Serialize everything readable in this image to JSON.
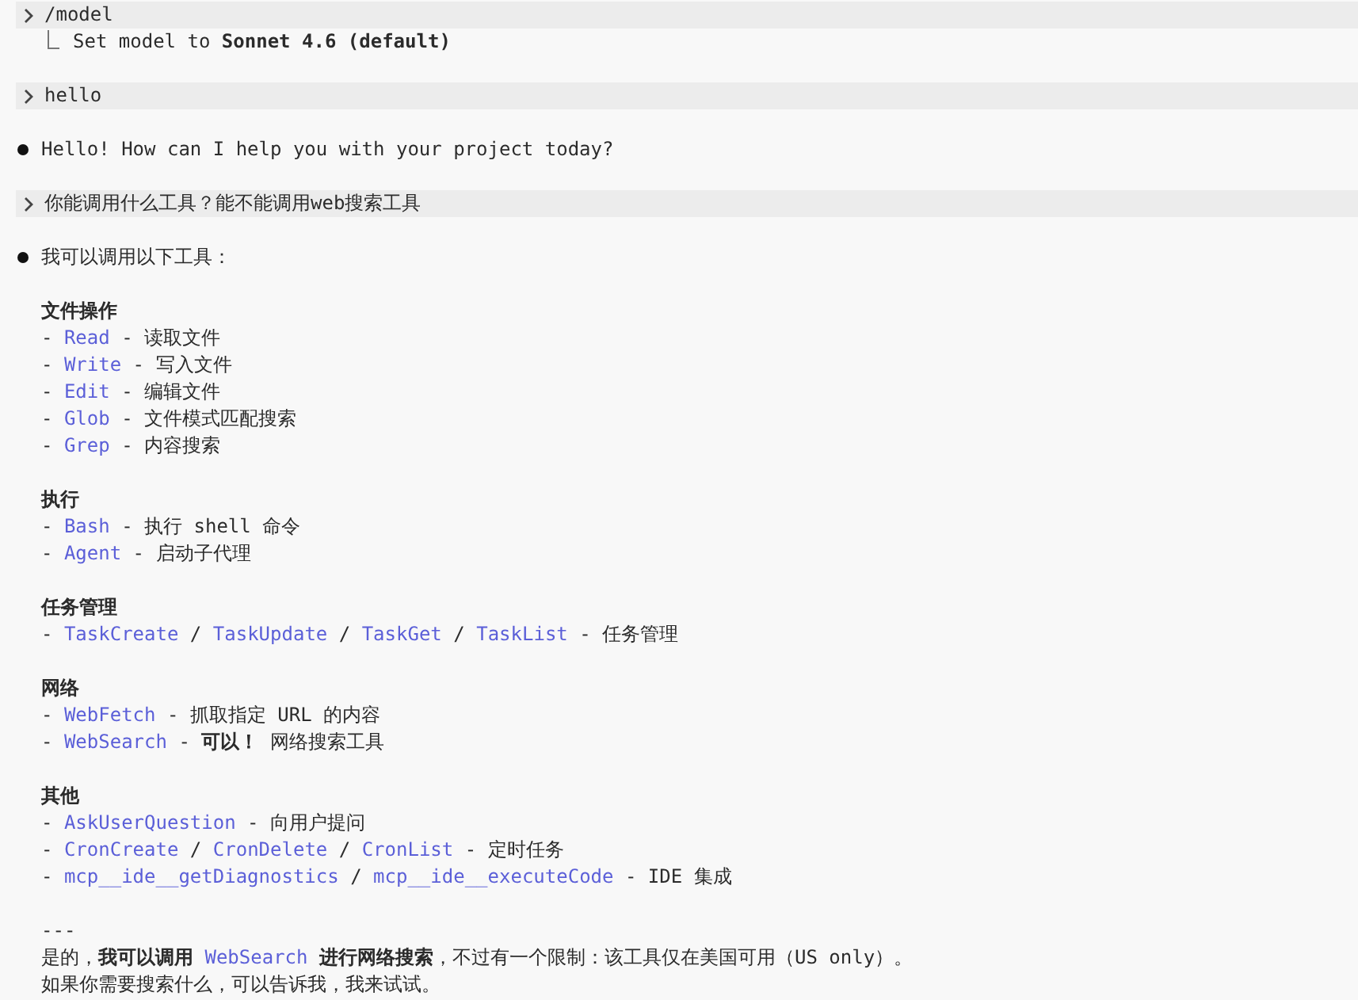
{
  "transcript": [
    {
      "kind": "prompt",
      "text": "/model",
      "result": "Set model to **Sonnet 4.6 (default)**"
    },
    {
      "kind": "prompt",
      "text": "hello"
    },
    {
      "kind": "reply",
      "intro": "Hello! How can I help you with your project today?"
    },
    {
      "kind": "prompt",
      "text": "你能调用什么工具？能不能调用web搜索工具"
    },
    {
      "kind": "reply",
      "intro": "我可以调用以下工具：",
      "sections": [
        {
          "heading": "文件操作",
          "items": [
            [
              {
                "kind": "text",
                "text": "- "
              },
              {
                "kind": "tool",
                "text": "Read"
              },
              {
                "kind": "text",
                "text": " - 读取文件"
              }
            ],
            [
              {
                "kind": "text",
                "text": "- "
              },
              {
                "kind": "tool",
                "text": "Write"
              },
              {
                "kind": "text",
                "text": " - 写入文件"
              }
            ],
            [
              {
                "kind": "text",
                "text": "- "
              },
              {
                "kind": "tool",
                "text": "Edit"
              },
              {
                "kind": "text",
                "text": " - 编辑文件"
              }
            ],
            [
              {
                "kind": "text",
                "text": "- "
              },
              {
                "kind": "tool",
                "text": "Glob"
              },
              {
                "kind": "text",
                "text": " - 文件模式匹配搜索"
              }
            ],
            [
              {
                "kind": "text",
                "text": "- "
              },
              {
                "kind": "tool",
                "text": "Grep"
              },
              {
                "kind": "text",
                "text": " - 内容搜索"
              }
            ]
          ]
        },
        {
          "heading": "执行",
          "items": [
            [
              {
                "kind": "text",
                "text": "- "
              },
              {
                "kind": "tool",
                "text": "Bash"
              },
              {
                "kind": "text",
                "text": " - 执行 shell 命令"
              }
            ],
            [
              {
                "kind": "text",
                "text": "- "
              },
              {
                "kind": "tool",
                "text": "Agent"
              },
              {
                "kind": "text",
                "text": " - 启动子代理"
              }
            ]
          ]
        },
        {
          "heading": "任务管理",
          "items": [
            [
              {
                "kind": "text",
                "text": "- "
              },
              {
                "kind": "tool",
                "text": "TaskCreate"
              },
              {
                "kind": "text",
                "text": " / "
              },
              {
                "kind": "tool",
                "text": "TaskUpdate"
              },
              {
                "kind": "text",
                "text": " / "
              },
              {
                "kind": "tool",
                "text": "TaskGet"
              },
              {
                "kind": "text",
                "text": " / "
              },
              {
                "kind": "tool",
                "text": "TaskList"
              },
              {
                "kind": "text",
                "text": " - 任务管理"
              }
            ]
          ]
        },
        {
          "heading": "网络",
          "items": [
            [
              {
                "kind": "text",
                "text": "- "
              },
              {
                "kind": "tool",
                "text": "WebFetch"
              },
              {
                "kind": "text",
                "text": " - 抓取指定 URL 的内容"
              }
            ],
            [
              {
                "kind": "text",
                "text": "- "
              },
              {
                "kind": "tool",
                "text": "WebSearch"
              },
              {
                "kind": "text",
                "text": " - **可以！** 网络搜索工具"
              }
            ]
          ]
        },
        {
          "heading": "其他",
          "items": [
            [
              {
                "kind": "text",
                "text": "- "
              },
              {
                "kind": "tool",
                "text": "AskUserQuestion"
              },
              {
                "kind": "text",
                "text": " - 向用户提问"
              }
            ],
            [
              {
                "kind": "text",
                "text": "- "
              },
              {
                "kind": "tool",
                "text": "CronCreate"
              },
              {
                "kind": "text",
                "text": " / "
              },
              {
                "kind": "tool",
                "text": "CronDelete"
              },
              {
                "kind": "text",
                "text": " / "
              },
              {
                "kind": "tool",
                "text": "CronList"
              },
              {
                "kind": "text",
                "text": " - 定时任务"
              }
            ],
            [
              {
                "kind": "text",
                "text": "- "
              },
              {
                "kind": "tool",
                "text": "mcp__ide__getDiagnostics"
              },
              {
                "kind": "text",
                "text": " / "
              },
              {
                "kind": "tool",
                "text": "mcp__ide__executeCode"
              },
              {
                "kind": "text",
                "text": " - IDE 集成"
              }
            ]
          ]
        }
      ],
      "rule": "---",
      "closing": [
        {
          "kind": "text",
          "text": "是的，**我可以调用** "
        },
        {
          "kind": "tool",
          "text": "WebSearch"
        },
        {
          "kind": "text",
          "text": " **进行网络搜索**，不过有一个限制：该工具仅在美国可用（US only）。如果你需要搜索什么，可以告诉我，我来试试。"
        }
      ]
    }
  ]
}
